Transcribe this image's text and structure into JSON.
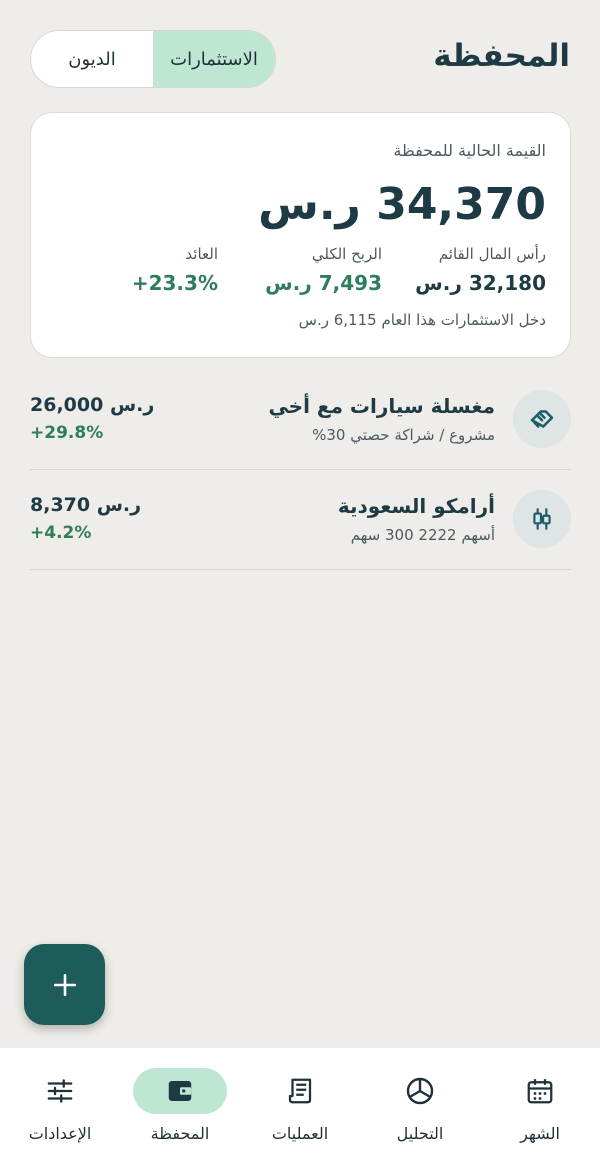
{
  "header": {
    "title": "المحفظة",
    "segments": [
      {
        "label": "الاستثمارات",
        "active": true
      },
      {
        "label": "الديون",
        "active": false
      }
    ]
  },
  "summary": {
    "label": "القيمة الحالية للمحفظة",
    "value": "34,370 ر.س",
    "stats": [
      {
        "label": "رأس المال القائم",
        "value": "32,180 ر.س"
      },
      {
        "label": "الربح الكلي",
        "value": "7,493 ر.س"
      },
      {
        "label": "العائد",
        "value": "+23.3%"
      }
    ],
    "income": "دخل الاستثمارات هذا العام 6,115 ر.س"
  },
  "investments": [
    {
      "name": "مغسلة سيارات مع أخي",
      "subtitle": "مشروع / شراكة  حصتي 30%",
      "amount": "26,000 ر.س",
      "change": "+29.8%",
      "icon": "handshake-icon"
    },
    {
      "name": "أرامكو السعودية",
      "subtitle": "أسهم  2222  300 سهم",
      "amount": "8,370 ر.س",
      "change": "+4.2%",
      "icon": "candlestick-icon"
    }
  ],
  "fab": {
    "icon": "plus-icon"
  },
  "nav": [
    {
      "label": "الشهر",
      "icon": "calendar-icon",
      "active": false
    },
    {
      "label": "التحليل",
      "icon": "pie-chart-icon",
      "active": false
    },
    {
      "label": "العمليات",
      "icon": "receipt-icon",
      "active": false
    },
    {
      "label": "المحفظة",
      "icon": "wallet-icon",
      "active": true
    },
    {
      "label": "الإعدادات",
      "icon": "sliders-icon",
      "active": false
    }
  ],
  "colors": {
    "background": "#eeede9",
    "accent": "#bfe6d3",
    "primary": "#1e5c5c",
    "positive": "#2f7d5b",
    "text": "#1e3a44"
  }
}
